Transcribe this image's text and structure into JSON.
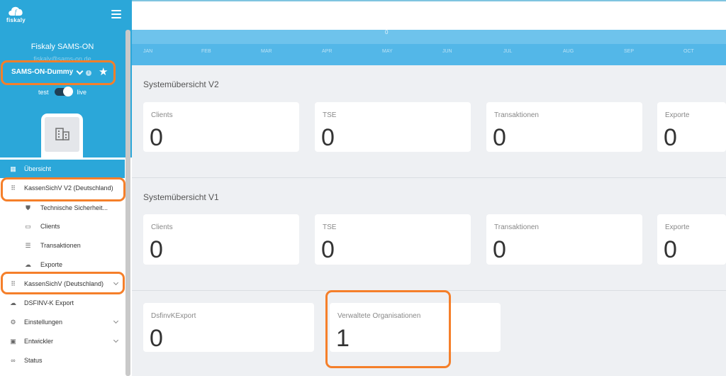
{
  "brand": {
    "logo_text": "fiskaly",
    "org_name": "Fiskaly SAMS-ON",
    "org_subtitle": "fiskaly@sams-on.de"
  },
  "org_select": {
    "value": "SAMS-ON-Dummy"
  },
  "env_toggle": {
    "left_label": "test",
    "right_label": "live"
  },
  "nav": {
    "overview": "Übersicht",
    "kassensichv_v2": "KassenSichV V2 (Deutschland)",
    "tse": "Technische Sicherheit...",
    "clients": "Clients",
    "transactions": "Transaktionen",
    "exports": "Exporte",
    "kassensichv": "KassenSichV (Deutschland)",
    "dsfinvk": "DSFINV-K Export",
    "settings": "Einstellungen",
    "developer": "Entwickler",
    "status": "Status"
  },
  "chart": {
    "zero_label": "0",
    "months": [
      "JAN",
      "FEB",
      "MAR",
      "APR",
      "MAY",
      "JUN",
      "JUL",
      "AUG",
      "SEP",
      "OCT"
    ]
  },
  "sections": {
    "v2": {
      "title": "Systemübersicht V2",
      "cards": [
        {
          "label": "Clients",
          "value": "0"
        },
        {
          "label": "TSE",
          "value": "0"
        },
        {
          "label": "Transaktionen",
          "value": "0"
        },
        {
          "label": "Exporte",
          "value": "0"
        }
      ]
    },
    "v1": {
      "title": "Systemübersicht V1",
      "cards": [
        {
          "label": "Clients",
          "value": "0"
        },
        {
          "label": "TSE",
          "value": "0"
        },
        {
          "label": "Transaktionen",
          "value": "0"
        },
        {
          "label": "Exporte",
          "value": "0"
        }
      ]
    },
    "other": {
      "cards": [
        {
          "label": "DsfinvKExport",
          "value": "0"
        },
        {
          "label": "Verwaltete Organisationen",
          "value": "1"
        }
      ]
    }
  },
  "colors": {
    "accent": "#2ba7d9",
    "highlight": "#f57f2a"
  }
}
